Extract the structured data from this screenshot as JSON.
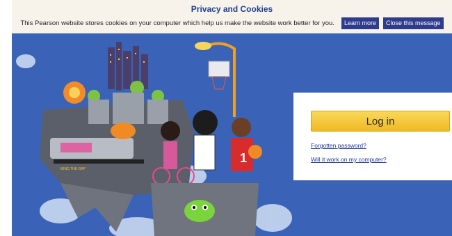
{
  "banner": {
    "title": "Privacy and Cookies",
    "text": "This Pearson website stores cookies on your computer which help us make the website work better for you.",
    "learn_more": "Learn more",
    "close": "Close this message"
  },
  "login": {
    "button": "Log in",
    "forgotten": "Forgotten password?",
    "will_it_work": "Will it work on my computer?"
  },
  "illustration": {
    "sign_text": "MIND THE GAP",
    "shirt_number": "1"
  },
  "colors": {
    "hero_bg": "#3a63b8",
    "banner_bg": "#f7f3eb",
    "button_yellow": "#f0b922",
    "accent_blue": "#2f3b8c"
  }
}
